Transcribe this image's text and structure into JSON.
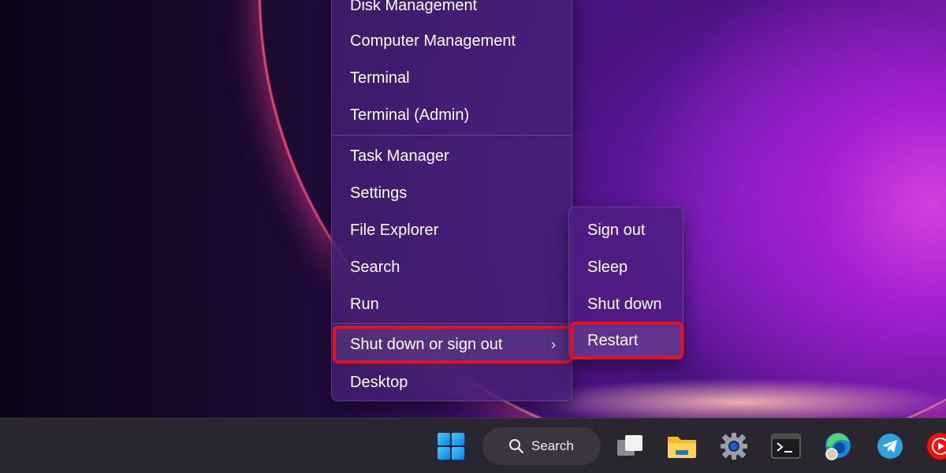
{
  "context_menu": {
    "items": [
      {
        "label": "Disk Management"
      },
      {
        "label": "Computer Management"
      },
      {
        "label": "Terminal"
      },
      {
        "label": "Terminal (Admin)"
      },
      {
        "label": "Task Manager"
      },
      {
        "label": "Settings"
      },
      {
        "label": "File Explorer"
      },
      {
        "label": "Search"
      },
      {
        "label": "Run"
      },
      {
        "label": "Shut down or sign out",
        "chevron": "›"
      },
      {
        "label": "Desktop"
      }
    ]
  },
  "submenu": {
    "items": [
      {
        "label": "Sign out"
      },
      {
        "label": "Sleep"
      },
      {
        "label": "Shut down"
      },
      {
        "label": "Restart"
      }
    ]
  },
  "taskbar": {
    "search_label": "Search",
    "icons": [
      "windows-start-icon",
      "search-icon",
      "task-view-icon",
      "file-explorer-icon",
      "settings-gear-icon",
      "terminal-icon",
      "edge-browser-icon",
      "telegram-icon",
      "youtube-icon"
    ]
  },
  "colors": {
    "highlight_outline": "#e8101c",
    "menu_background": "#46227a",
    "taskbar_background": "#2a2630"
  }
}
